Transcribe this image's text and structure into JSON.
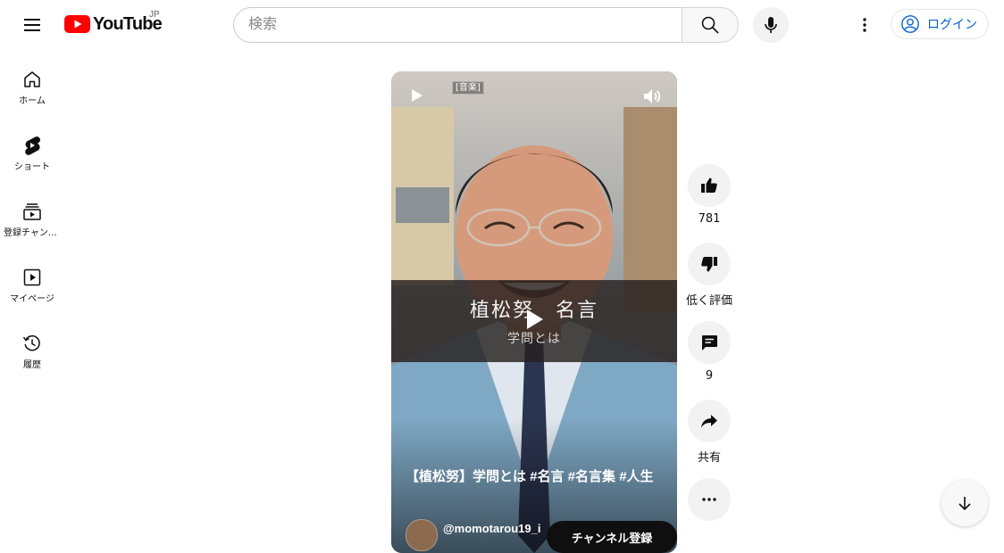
{
  "header": {
    "logo_text": "YouTube",
    "country_code": "JP",
    "search_placeholder": "検索",
    "login_label": "ログイン"
  },
  "sidebar": {
    "items": [
      {
        "label": "ホーム",
        "icon": "home-icon"
      },
      {
        "label": "ショート",
        "icon": "shorts-icon"
      },
      {
        "label": "登録チャンネル",
        "icon": "subscriptions-icon"
      },
      {
        "label": "マイページ",
        "icon": "you-icon"
      },
      {
        "label": "履歴",
        "icon": "history-icon"
      }
    ]
  },
  "video": {
    "genre_tag": "[音楽]",
    "subtitle_title": "植松努　名言",
    "subtitle_sub": "学問とは",
    "title": "【植松努】学問とは #名言 #名言集 #人生",
    "channel": "@momotarou19_i",
    "subscribe_label": "チャンネル登録"
  },
  "actions": {
    "like_count": "781",
    "dislike_label": "低く評価",
    "comment_count": "9",
    "share_label": "共有"
  },
  "colors": {
    "brand_red": "#ff0000",
    "link_blue": "#065fd4",
    "chip_bg": "#f2f2f2"
  }
}
